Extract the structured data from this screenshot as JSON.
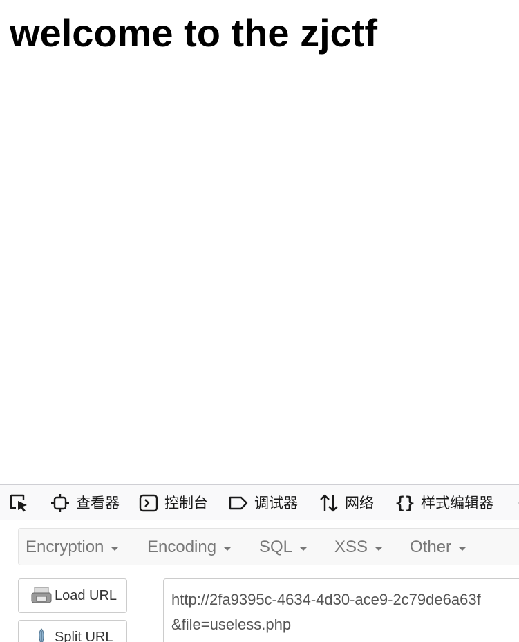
{
  "page": {
    "heading": "welcome to the zjctf"
  },
  "devtools": {
    "picker_icon": "element-picker-icon",
    "tabs": [
      {
        "icon": "inspector-icon",
        "label": "查看器"
      },
      {
        "icon": "console-icon",
        "label": "控制台"
      },
      {
        "icon": "debugger-icon",
        "label": "调试器"
      },
      {
        "icon": "network-icon",
        "label": "网络"
      },
      {
        "icon": "style-editor-icon",
        "label": "样式编辑器"
      }
    ]
  },
  "hackbar": {
    "menu": [
      {
        "label": "Encryption"
      },
      {
        "label": "Encoding"
      },
      {
        "label": "SQL"
      },
      {
        "label": "XSS"
      },
      {
        "label": "Other"
      }
    ],
    "buttons": {
      "load_url": "Load URL",
      "split_url": "Split URL"
    },
    "url_value": "http://2fa9395c-4634-4d30-ace9-2c79de6a63f\n&file=useless.php"
  },
  "colors": {
    "menu_text": "#777777",
    "toolbar_bg": "#f9f9fa"
  }
}
